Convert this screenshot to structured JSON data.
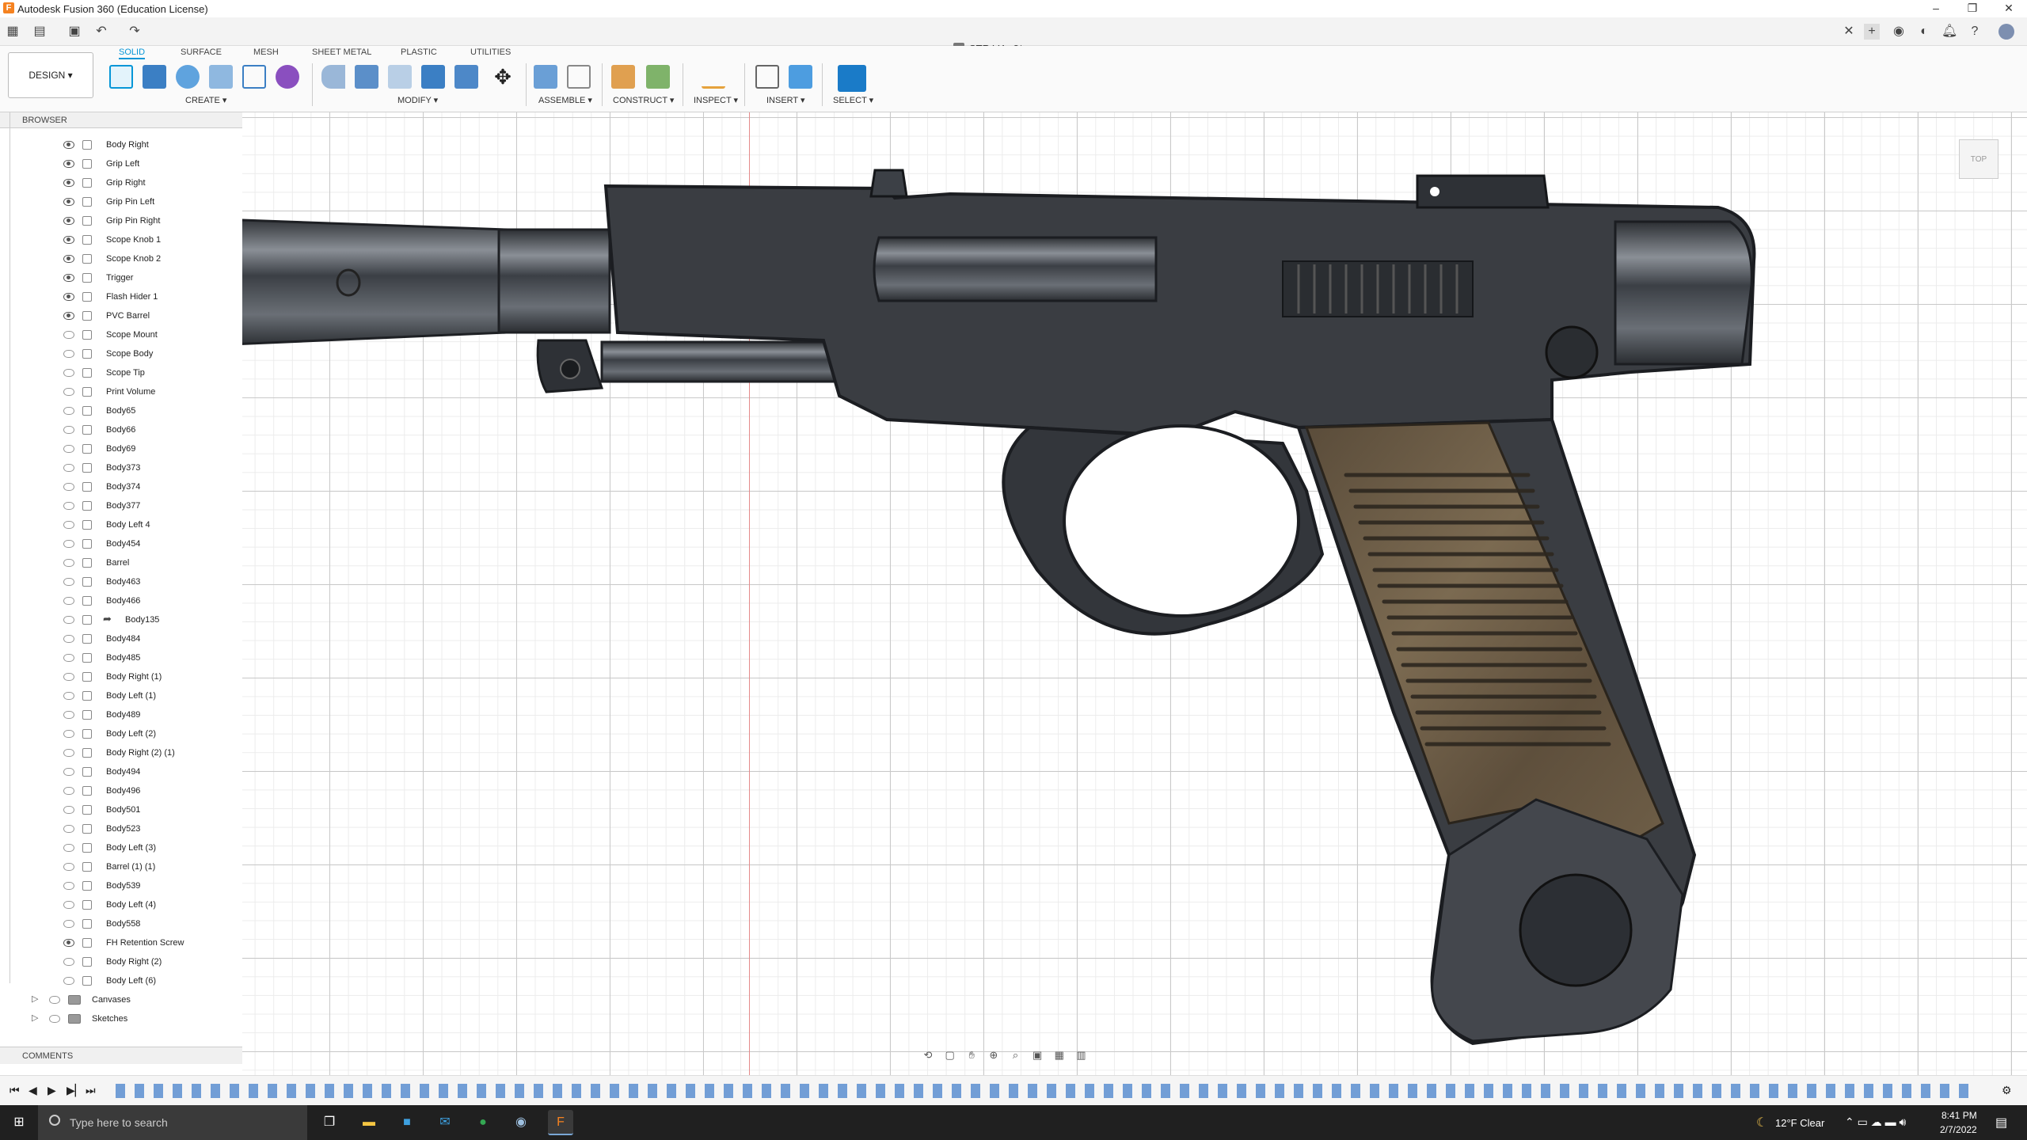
{
  "app": {
    "title": "Autodesk Fusion 360 (Education License)"
  },
  "document": {
    "tab_title": "STR V4 v8*"
  },
  "workspace": {
    "label": "DESIGN ▾"
  },
  "ribbon": {
    "tabs": [
      "SOLID",
      "SURFACE",
      "MESH",
      "SHEET METAL",
      "PLASTIC",
      "UTILITIES"
    ],
    "active_tab": "SOLID",
    "groups": [
      "CREATE ▾",
      "MODIFY ▾",
      "ASSEMBLE ▾",
      "CONSTRUCT ▾",
      "INSPECT ▾",
      "INSERT ▾",
      "SELECT ▾"
    ]
  },
  "browser": {
    "title": "BROWSER",
    "items": [
      {
        "label": "Body Right",
        "visible": true
      },
      {
        "label": "Grip Left",
        "visible": true
      },
      {
        "label": "Grip Right",
        "visible": true
      },
      {
        "label": "Grip Pin Left",
        "visible": true
      },
      {
        "label": "Grip Pin Right",
        "visible": true
      },
      {
        "label": "Scope Knob 1",
        "visible": true
      },
      {
        "label": "Scope Knob 2",
        "visible": true
      },
      {
        "label": "Trigger",
        "visible": true
      },
      {
        "label": "Flash Hider 1",
        "visible": true
      },
      {
        "label": "PVC Barrel",
        "visible": true
      },
      {
        "label": "Scope Mount",
        "visible": false
      },
      {
        "label": "Scope Body",
        "visible": false
      },
      {
        "label": "Scope Tip",
        "visible": false
      },
      {
        "label": "Print Volume",
        "visible": false
      },
      {
        "label": "Body65",
        "visible": false
      },
      {
        "label": "Body66",
        "visible": false
      },
      {
        "label": "Body69",
        "visible": false
      },
      {
        "label": "Body373",
        "visible": false
      },
      {
        "label": "Body374",
        "visible": false
      },
      {
        "label": "Body377",
        "visible": false
      },
      {
        "label": "Body Left 4",
        "visible": false
      },
      {
        "label": "Body454",
        "visible": false
      },
      {
        "label": "Barrel",
        "visible": false
      },
      {
        "label": "Body463",
        "visible": false
      },
      {
        "label": "Body466",
        "visible": false
      },
      {
        "label": "Body135",
        "visible": false,
        "link": true
      },
      {
        "label": "Body484",
        "visible": false
      },
      {
        "label": "Body485",
        "visible": false
      },
      {
        "label": "Body Right (1)",
        "visible": false
      },
      {
        "label": "Body Left (1)",
        "visible": false
      },
      {
        "label": "Body489",
        "visible": false
      },
      {
        "label": "Body Left (2)",
        "visible": false
      },
      {
        "label": "Body Right (2) (1)",
        "visible": false
      },
      {
        "label": "Body494",
        "visible": false
      },
      {
        "label": "Body496",
        "visible": false
      },
      {
        "label": "Body501",
        "visible": false
      },
      {
        "label": "Body523",
        "visible": false
      },
      {
        "label": "Body Left (3)",
        "visible": false
      },
      {
        "label": "Barrel (1) (1)",
        "visible": false
      },
      {
        "label": "Body539",
        "visible": false
      },
      {
        "label": "Body Left (4)",
        "visible": false
      },
      {
        "label": "Body558",
        "visible": false
      },
      {
        "label": "FH Retention Screw",
        "visible": true
      },
      {
        "label": "Body Right (2)",
        "visible": false
      },
      {
        "label": "Body Left (6)",
        "visible": false
      }
    ],
    "folders": [
      "Canvases",
      "Sketches"
    ]
  },
  "comments": {
    "title": "COMMENTS"
  },
  "viewcube": {
    "face": "TOP"
  },
  "taskbar": {
    "search_placeholder": "Type here to search",
    "weather": "12°F  Clear",
    "time": "8:41 PM",
    "date": "2/7/2022"
  },
  "colors": {
    "accent": "#0696d7",
    "gun_body": "#3a3d42",
    "grip": "#6b5b45"
  }
}
